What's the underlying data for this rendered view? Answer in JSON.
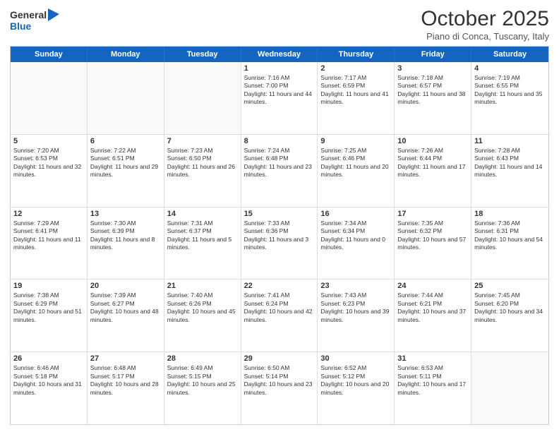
{
  "header": {
    "logo": {
      "general": "General",
      "blue": "Blue"
    },
    "month": "October 2025",
    "location": "Piano di Conca, Tuscany, Italy"
  },
  "days": [
    "Sunday",
    "Monday",
    "Tuesday",
    "Wednesday",
    "Thursday",
    "Friday",
    "Saturday"
  ],
  "rows": [
    [
      {
        "day": "",
        "info": ""
      },
      {
        "day": "",
        "info": ""
      },
      {
        "day": "",
        "info": ""
      },
      {
        "day": "1",
        "info": "Sunrise: 7:16 AM\nSunset: 7:00 PM\nDaylight: 11 hours and 44 minutes."
      },
      {
        "day": "2",
        "info": "Sunrise: 7:17 AM\nSunset: 6:59 PM\nDaylight: 11 hours and 41 minutes."
      },
      {
        "day": "3",
        "info": "Sunrise: 7:18 AM\nSunset: 6:57 PM\nDaylight: 11 hours and 38 minutes."
      },
      {
        "day": "4",
        "info": "Sunrise: 7:19 AM\nSunset: 6:55 PM\nDaylight: 11 hours and 35 minutes."
      }
    ],
    [
      {
        "day": "5",
        "info": "Sunrise: 7:20 AM\nSunset: 6:53 PM\nDaylight: 11 hours and 32 minutes."
      },
      {
        "day": "6",
        "info": "Sunrise: 7:22 AM\nSunset: 6:51 PM\nDaylight: 11 hours and 29 minutes."
      },
      {
        "day": "7",
        "info": "Sunrise: 7:23 AM\nSunset: 6:50 PM\nDaylight: 11 hours and 26 minutes."
      },
      {
        "day": "8",
        "info": "Sunrise: 7:24 AM\nSunset: 6:48 PM\nDaylight: 11 hours and 23 minutes."
      },
      {
        "day": "9",
        "info": "Sunrise: 7:25 AM\nSunset: 6:46 PM\nDaylight: 11 hours and 20 minutes."
      },
      {
        "day": "10",
        "info": "Sunrise: 7:26 AM\nSunset: 6:44 PM\nDaylight: 11 hours and 17 minutes."
      },
      {
        "day": "11",
        "info": "Sunrise: 7:28 AM\nSunset: 6:43 PM\nDaylight: 11 hours and 14 minutes."
      }
    ],
    [
      {
        "day": "12",
        "info": "Sunrise: 7:29 AM\nSunset: 6:41 PM\nDaylight: 11 hours and 11 minutes."
      },
      {
        "day": "13",
        "info": "Sunrise: 7:30 AM\nSunset: 6:39 PM\nDaylight: 11 hours and 8 minutes."
      },
      {
        "day": "14",
        "info": "Sunrise: 7:31 AM\nSunset: 6:37 PM\nDaylight: 11 hours and 5 minutes."
      },
      {
        "day": "15",
        "info": "Sunrise: 7:33 AM\nSunset: 6:36 PM\nDaylight: 11 hours and 3 minutes."
      },
      {
        "day": "16",
        "info": "Sunrise: 7:34 AM\nSunset: 6:34 PM\nDaylight: 11 hours and 0 minutes."
      },
      {
        "day": "17",
        "info": "Sunrise: 7:35 AM\nSunset: 6:32 PM\nDaylight: 10 hours and 57 minutes."
      },
      {
        "day": "18",
        "info": "Sunrise: 7:36 AM\nSunset: 6:31 PM\nDaylight: 10 hours and 54 minutes."
      }
    ],
    [
      {
        "day": "19",
        "info": "Sunrise: 7:38 AM\nSunset: 6:29 PM\nDaylight: 10 hours and 51 minutes."
      },
      {
        "day": "20",
        "info": "Sunrise: 7:39 AM\nSunset: 6:27 PM\nDaylight: 10 hours and 48 minutes."
      },
      {
        "day": "21",
        "info": "Sunrise: 7:40 AM\nSunset: 6:26 PM\nDaylight: 10 hours and 45 minutes."
      },
      {
        "day": "22",
        "info": "Sunrise: 7:41 AM\nSunset: 6:24 PM\nDaylight: 10 hours and 42 minutes."
      },
      {
        "day": "23",
        "info": "Sunrise: 7:43 AM\nSunset: 6:23 PM\nDaylight: 10 hours and 39 minutes."
      },
      {
        "day": "24",
        "info": "Sunrise: 7:44 AM\nSunset: 6:21 PM\nDaylight: 10 hours and 37 minutes."
      },
      {
        "day": "25",
        "info": "Sunrise: 7:45 AM\nSunset: 6:20 PM\nDaylight: 10 hours and 34 minutes."
      }
    ],
    [
      {
        "day": "26",
        "info": "Sunrise: 6:46 AM\nSunset: 5:18 PM\nDaylight: 10 hours and 31 minutes."
      },
      {
        "day": "27",
        "info": "Sunrise: 6:48 AM\nSunset: 5:17 PM\nDaylight: 10 hours and 28 minutes."
      },
      {
        "day": "28",
        "info": "Sunrise: 6:49 AM\nSunset: 5:15 PM\nDaylight: 10 hours and 25 minutes."
      },
      {
        "day": "29",
        "info": "Sunrise: 6:50 AM\nSunset: 5:14 PM\nDaylight: 10 hours and 23 minutes."
      },
      {
        "day": "30",
        "info": "Sunrise: 6:52 AM\nSunset: 5:12 PM\nDaylight: 10 hours and 20 minutes."
      },
      {
        "day": "31",
        "info": "Sunrise: 6:53 AM\nSunset: 5:11 PM\nDaylight: 10 hours and 17 minutes."
      },
      {
        "day": "",
        "info": ""
      }
    ]
  ]
}
